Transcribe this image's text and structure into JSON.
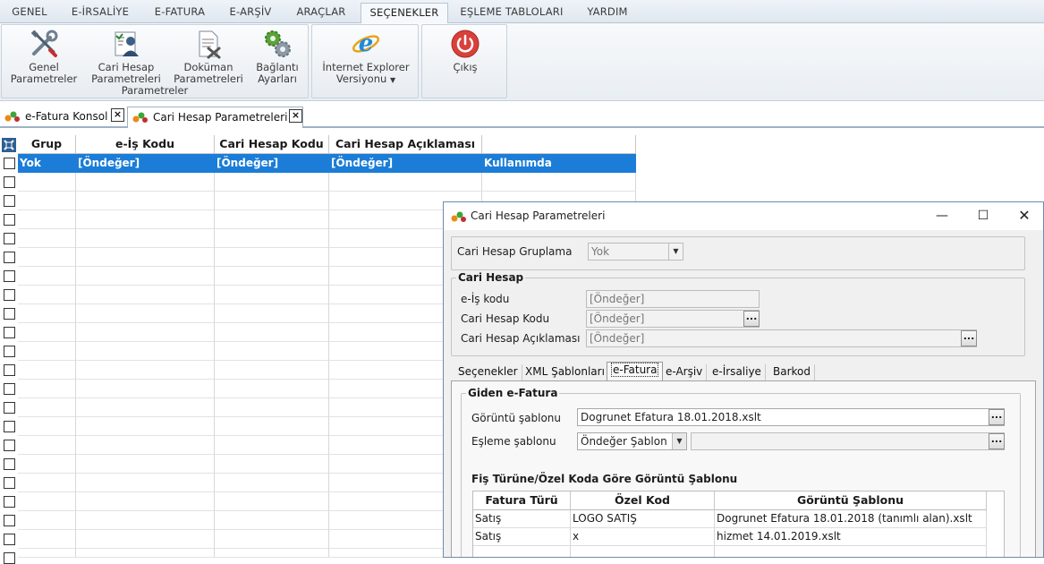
{
  "menu": {
    "tabs": [
      "GENEL",
      "E-İRSALİYE",
      "E-FATURA",
      "E-ARŞİV",
      "ARAÇLAR",
      "SEÇENEKLER",
      "EŞLEME TABLOLARI",
      "YARDIM"
    ],
    "active_tab": "SEÇENEKLER"
  },
  "ribbon": {
    "group_caption": "Parametreler",
    "buttons": {
      "genel": {
        "line1": "Genel",
        "line2": "Parametreler",
        "icon": "tools-icon"
      },
      "cari_hesap": {
        "line1": "Cari Hesap",
        "line2": "Parametreleri",
        "icon": "user-settings-icon"
      },
      "dokuman": {
        "line1": "Doküman",
        "line2": "Parametreleri",
        "icon": "document-settings-icon"
      },
      "baglanti": {
        "line1": "Bağlantı",
        "line2": "Ayarları",
        "icon": "gears-icon"
      },
      "ie": {
        "line1": "İnternet Explorer",
        "line2": "Versiyonu",
        "icon": "internet-explorer-icon"
      },
      "cikis": {
        "line1": "Çıkış",
        "icon": "power-icon"
      }
    }
  },
  "doc_tabs": [
    {
      "label": "e-Fatura Konsol"
    },
    {
      "label": "Cari Hesap Parametreleri"
    }
  ],
  "grid": {
    "columns": [
      "Grup",
      "e-İş Kodu",
      "Cari Hesap Kodu",
      "Cari Hesap Açıklaması",
      ""
    ],
    "rows": [
      [
        "Yok",
        "[Öndeğer]",
        "[Öndeğer]",
        "[Öndeğer]",
        "Kullanımda"
      ]
    ]
  },
  "dialog": {
    "title": "Cari Hesap Parametreleri",
    "grouping_label": "Cari Hesap Gruplama",
    "grouping_value": "Yok",
    "cari_hesap_legend": "Cari Hesap",
    "eis_label": "e-İş kodu",
    "eis_value": "[Öndeğer]",
    "kod_label": "Cari Hesap Kodu",
    "kod_value": "[Öndeğer]",
    "aciklama_label": "Cari Hesap Açıklaması",
    "aciklama_value": "[Öndeğer]",
    "dots": "...",
    "inner_tabs": [
      "Seçenekler",
      "XML Şablonları",
      "e-Fatura",
      "e-Arşiv",
      "e-İrsaliye",
      "Barkod"
    ],
    "active_inner_tab": "e-Fatura",
    "giden_legend": "Giden e-Fatura",
    "goruntu_label": "Görüntü şablonu",
    "goruntu_value": "Dogrunet Efatura 18.01.2018.xslt",
    "esleme_label": "Eşleme şablonu",
    "esleme_value": "Öndeğer Şablon",
    "esleme_path": "",
    "fis_title": "Fiş Türüne/Özel Koda Göre Görüntü Şablonu",
    "table_columns": [
      "Fatura Türü",
      "Özel Kod",
      "Görüntü Şablonu"
    ],
    "table_rows": [
      [
        "Satış",
        "LOGO SATIŞ",
        "Dogrunet Efatura 18.01.2018 (tanımlı alan).xslt"
      ],
      [
        "Satış",
        "x",
        "hizmet 14.01.2019.xslt"
      ]
    ]
  }
}
